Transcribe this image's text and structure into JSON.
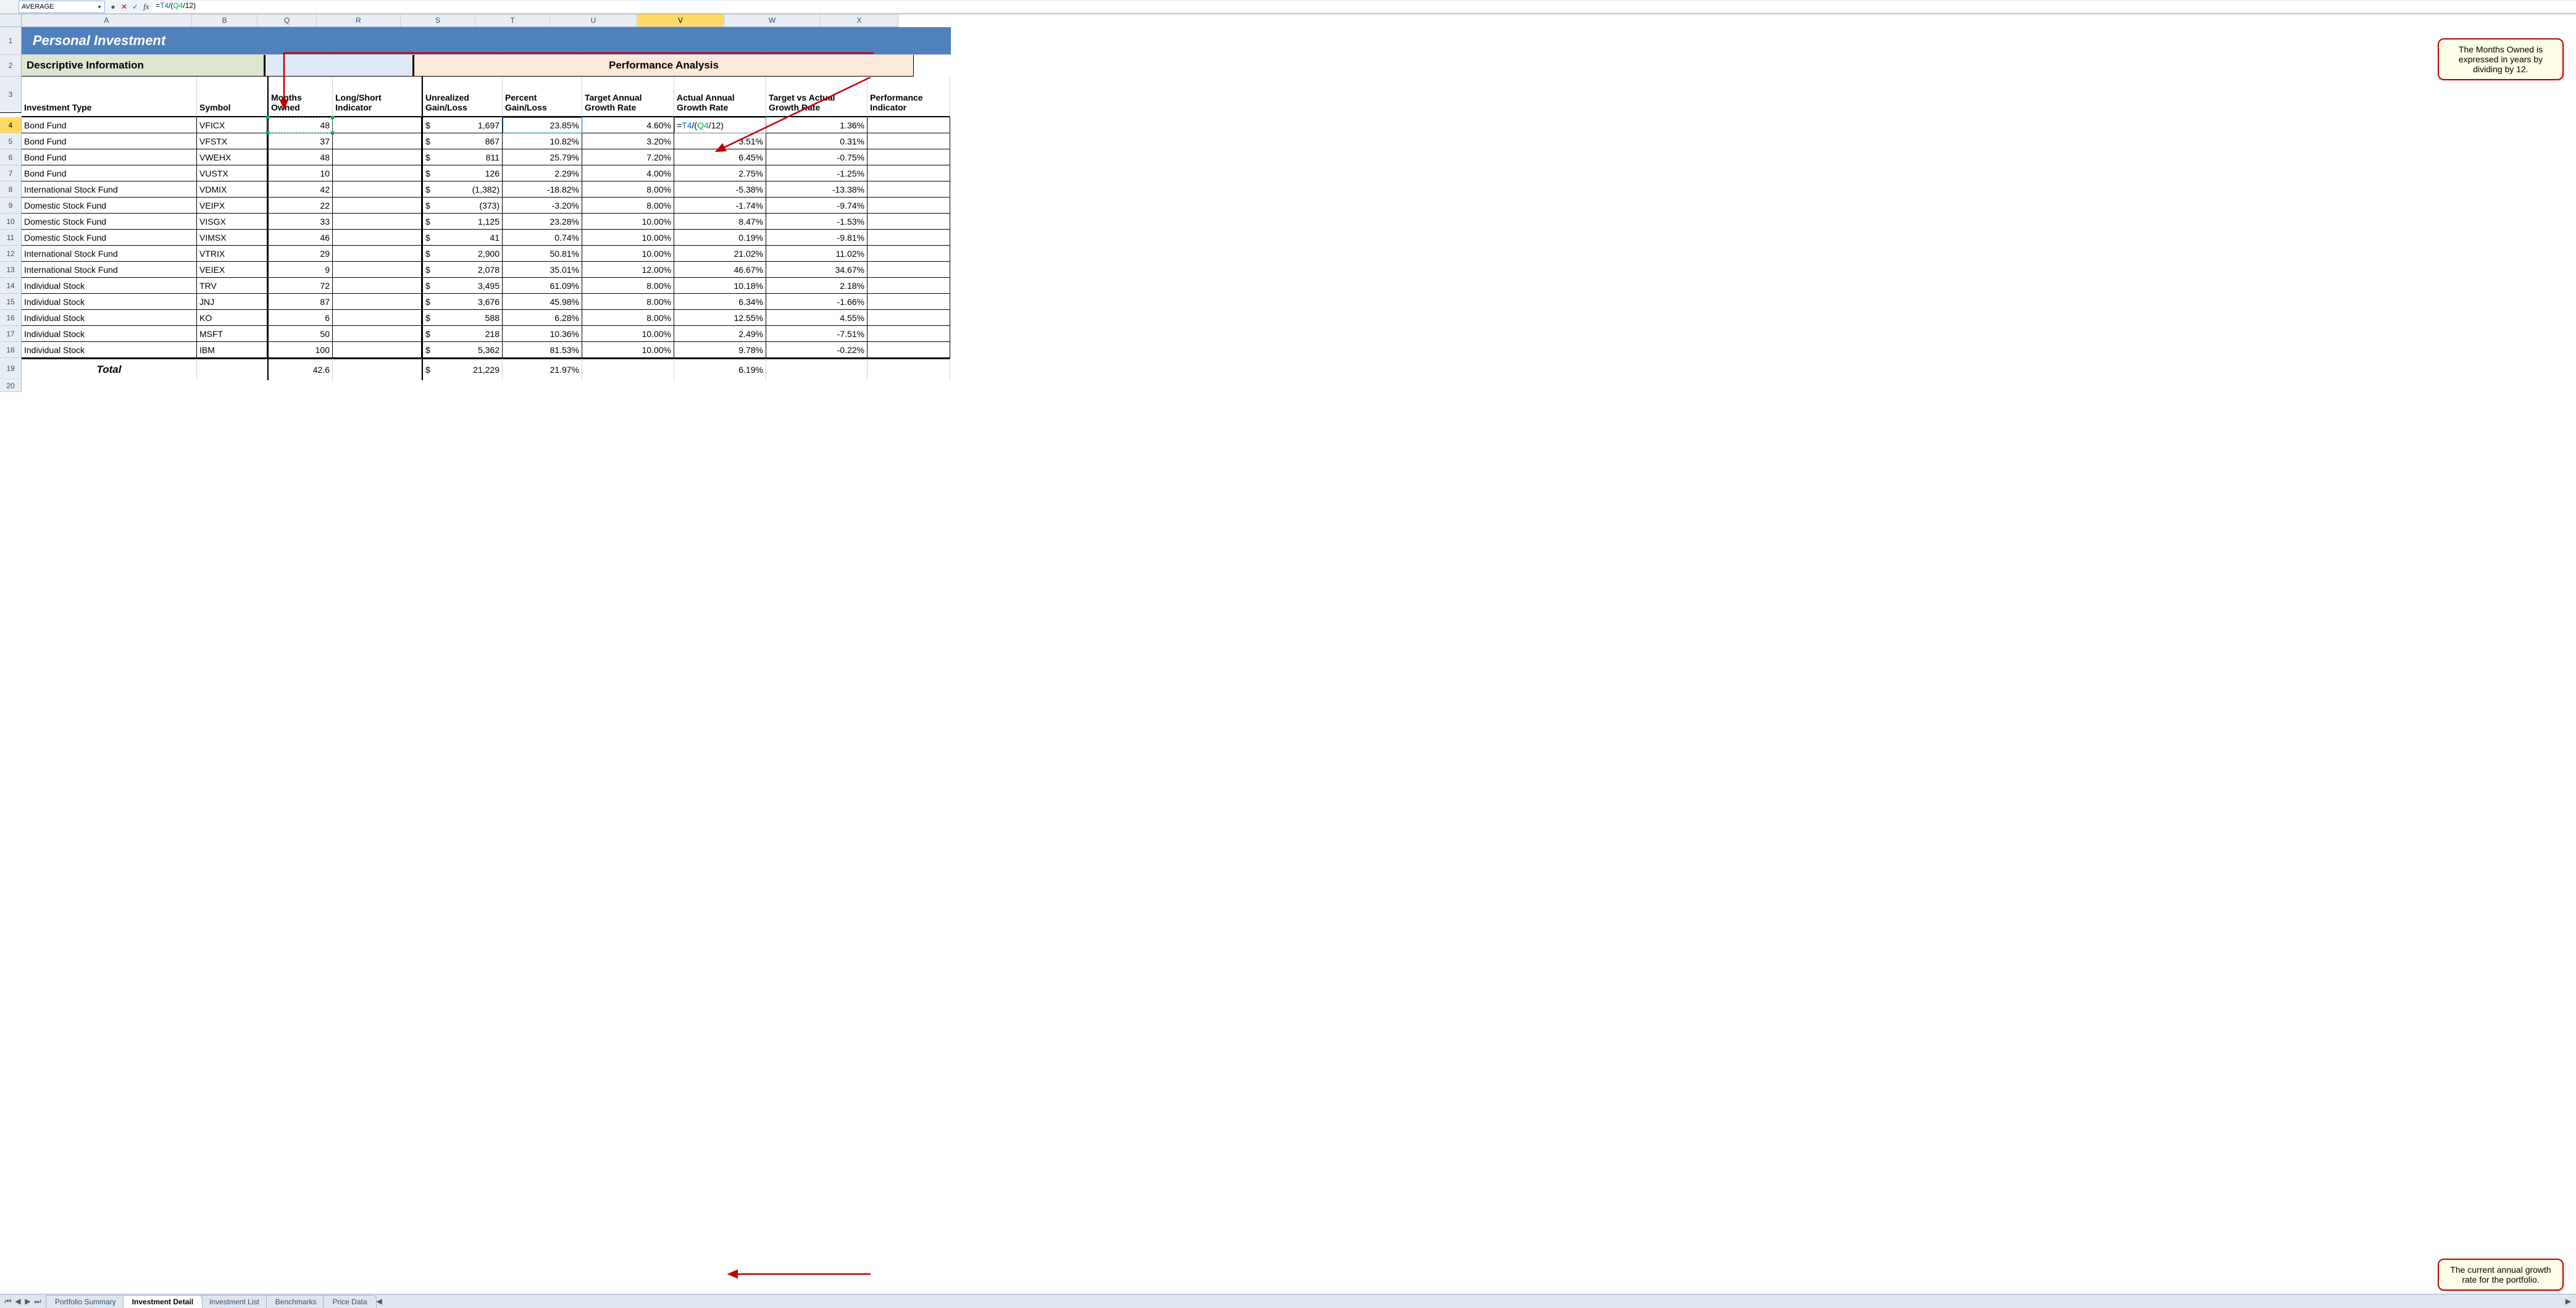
{
  "nameBox": "AVERAGE",
  "formula": "=T4/(Q4/12)",
  "title": "Personal Investment",
  "section1": "Descriptive Information",
  "section2": "Performance Analysis",
  "cols": [
    "A",
    "B",
    "Q",
    "R",
    "S",
    "T",
    "U",
    "V",
    "W",
    "X"
  ],
  "headers": {
    "A": "Investment Type",
    "B": "Symbol",
    "Q": "Months Owned",
    "R": "Long/Short Indicator",
    "S": "Unrealized Gain/Loss",
    "T": "Percent Gain/Loss",
    "U": "Target Annual Growth Rate",
    "V": "Actual Annual Growth Rate",
    "W": "Target vs Actual Growth Rate",
    "X": "Performance Indicator"
  },
  "rows": [
    {
      "r": 4,
      "A": "Bond Fund",
      "B": "VFICX",
      "Q": "48",
      "S": "1,697",
      "T": "23.85%",
      "U": "4.60%",
      "V": "=T4/(Q4/12)",
      "W": "1.36%"
    },
    {
      "r": 5,
      "A": "Bond Fund",
      "B": "VFSTX",
      "Q": "37",
      "S": "867",
      "T": "10.82%",
      "U": "3.20%",
      "V": "3.51%",
      "W": "0.31%"
    },
    {
      "r": 6,
      "A": "Bond Fund",
      "B": "VWEHX",
      "Q": "48",
      "S": "811",
      "T": "25.79%",
      "U": "7.20%",
      "V": "6.45%",
      "W": "-0.75%"
    },
    {
      "r": 7,
      "A": "Bond Fund",
      "B": "VUSTX",
      "Q": "10",
      "S": "126",
      "T": "2.29%",
      "U": "4.00%",
      "V": "2.75%",
      "W": "-1.25%"
    },
    {
      "r": 8,
      "A": "International Stock Fund",
      "B": "VDMIX",
      "Q": "42",
      "S": "(1,382)",
      "T": "-18.82%",
      "U": "8.00%",
      "V": "-5.38%",
      "W": "-13.38%"
    },
    {
      "r": 9,
      "A": "Domestic Stock Fund",
      "B": "VEIPX",
      "Q": "22",
      "S": "(373)",
      "Sp": "   ",
      "T": "-3.20%",
      "U": "8.00%",
      "V": "-1.74%",
      "W": "-9.74%"
    },
    {
      "r": 10,
      "A": "Domestic Stock Fund",
      "B": "VISGX",
      "Q": "33",
      "S": "1,125",
      "T": "23.28%",
      "U": "10.00%",
      "V": "8.47%",
      "W": "-1.53%"
    },
    {
      "r": 11,
      "A": "Domestic Stock Fund",
      "B": "VIMSX",
      "Q": "46",
      "S": "41",
      "T": "0.74%",
      "U": "10.00%",
      "V": "0.19%",
      "W": "-9.81%"
    },
    {
      "r": 12,
      "A": "International Stock Fund",
      "B": "VTRIX",
      "Q": "29",
      "S": "2,900",
      "T": "50.81%",
      "U": "10.00%",
      "V": "21.02%",
      "W": "11.02%"
    },
    {
      "r": 13,
      "A": "International Stock Fund",
      "B": "VEIEX",
      "Q": "9",
      "S": "2,078",
      "T": "35.01%",
      "U": "12.00%",
      "V": "46.67%",
      "W": "34.67%"
    },
    {
      "r": 14,
      "A": "Individual Stock",
      "B": "TRV",
      "Q": "72",
      "S": "3,495",
      "T": "61.09%",
      "U": "8.00%",
      "V": "10.18%",
      "W": "2.18%"
    },
    {
      "r": 15,
      "A": "Individual Stock",
      "B": "JNJ",
      "Q": "87",
      "S": "3,676",
      "T": "45.98%",
      "U": "8.00%",
      "V": "6.34%",
      "W": "-1.66%"
    },
    {
      "r": 16,
      "A": "Individual Stock",
      "B": "KO",
      "Q": "6",
      "S": "588",
      "T": "6.28%",
      "U": "8.00%",
      "V": "12.55%",
      "W": "4.55%"
    },
    {
      "r": 17,
      "A": "Individual Stock",
      "B": "MSFT",
      "Q": "50",
      "S": "218",
      "T": "10.36%",
      "U": "10.00%",
      "V": "2.49%",
      "W": "-7.51%"
    },
    {
      "r": 18,
      "A": "Individual Stock",
      "B": "IBM",
      "Q": "100",
      "S": "5,362",
      "T": "81.53%",
      "U": "10.00%",
      "V": "9.78%",
      "W": "-0.22%"
    }
  ],
  "total": {
    "label": "Total",
    "Q": "42.6",
    "S": "21,229",
    "T": "21.97%",
    "V": "6.19%"
  },
  "tabs": [
    "Portfolio Summary",
    "Investment Detail",
    "Investment List",
    "Benchmarks",
    "Price Data"
  ],
  "activeTab": 1,
  "callout1": "The Months Owned is expressed in years by dividing by 12.",
  "callout2": "The current annual growth rate for the portfolio."
}
